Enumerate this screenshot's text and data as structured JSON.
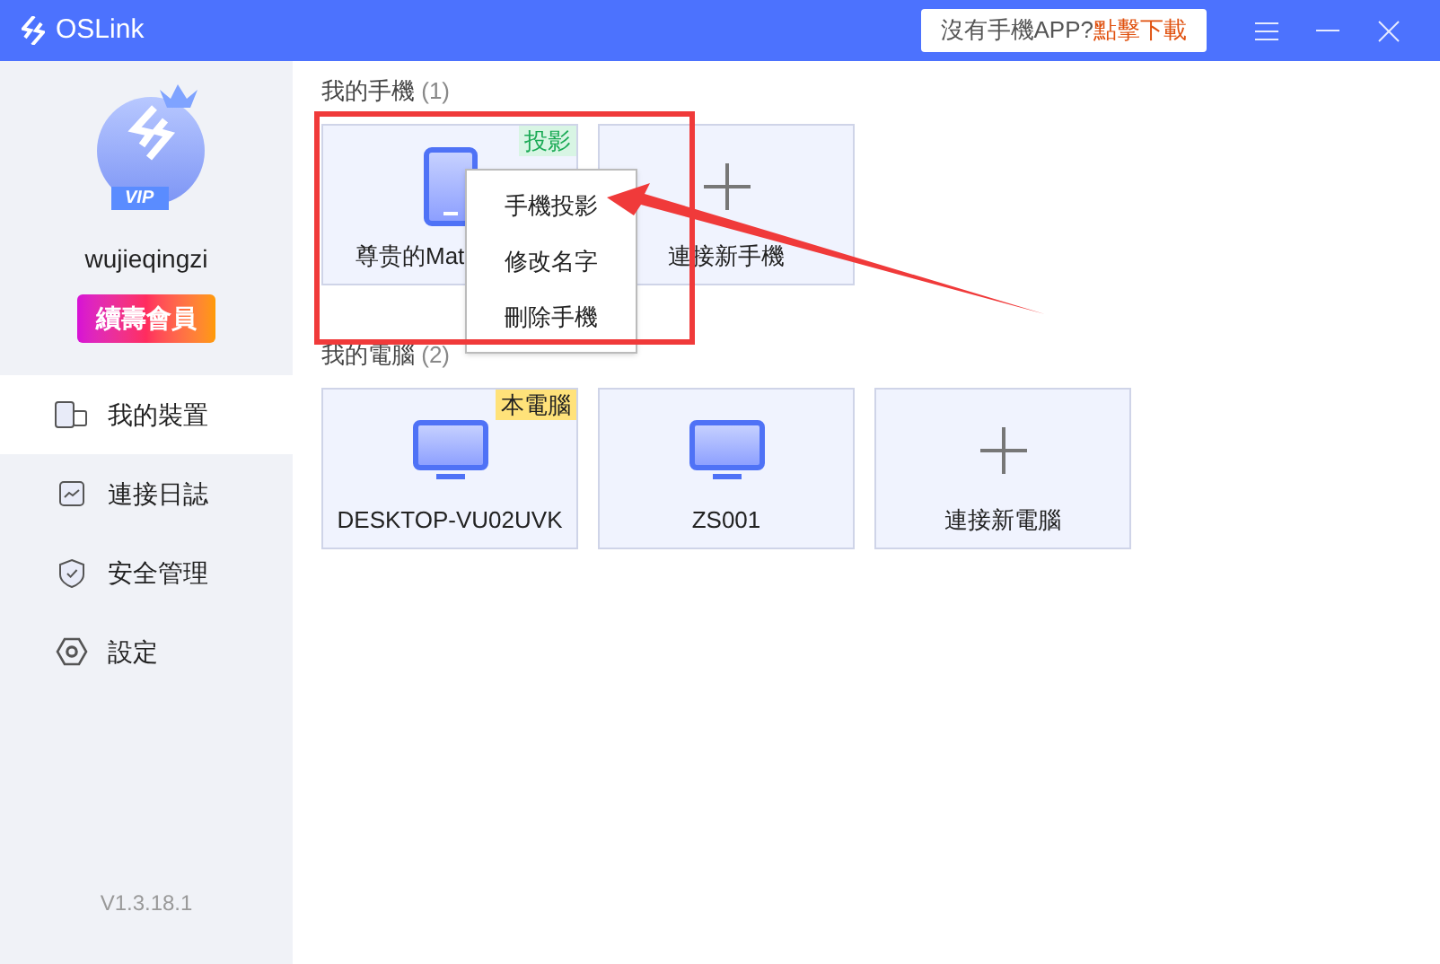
{
  "window": {
    "title": "OSLink"
  },
  "download_banner": {
    "text": "沒有手機APP?",
    "link": "點擊下載"
  },
  "profile": {
    "badge": "VIP",
    "username": "wujieqingzi",
    "renew_button": "續壽會員"
  },
  "sidebar": {
    "items": [
      {
        "label": "我的裝置",
        "kind": "devices",
        "selected": true
      },
      {
        "label": "連接日誌",
        "kind": "log",
        "selected": false
      },
      {
        "label": "安全管理",
        "kind": "shield",
        "selected": false
      },
      {
        "label": "設定",
        "kind": "settings",
        "selected": false
      }
    ],
    "version": "V1.3.18.1"
  },
  "sections": [
    {
      "title": "我的手機",
      "count": "(1)",
      "cards": [
        {
          "kind": "phone",
          "name": "尊贵的Mat",
          "tag": "投影",
          "color": "#d8f5e4"
        },
        {
          "kind": "add",
          "name": "連接新手機"
        }
      ]
    },
    {
      "title": "我的電腦",
      "count": "(2)",
      "cards": [
        {
          "kind": "computer",
          "name": "DESKTOP-VU02UVK",
          "tag": "本電腦",
          "color": "#ffe27a"
        },
        {
          "kind": "computer",
          "name": "ZS001"
        },
        {
          "kind": "add",
          "name": "連接新電腦"
        }
      ]
    }
  ],
  "context_menu": {
    "items": [
      "手機投影",
      "修改名字",
      "刪除手機"
    ]
  }
}
